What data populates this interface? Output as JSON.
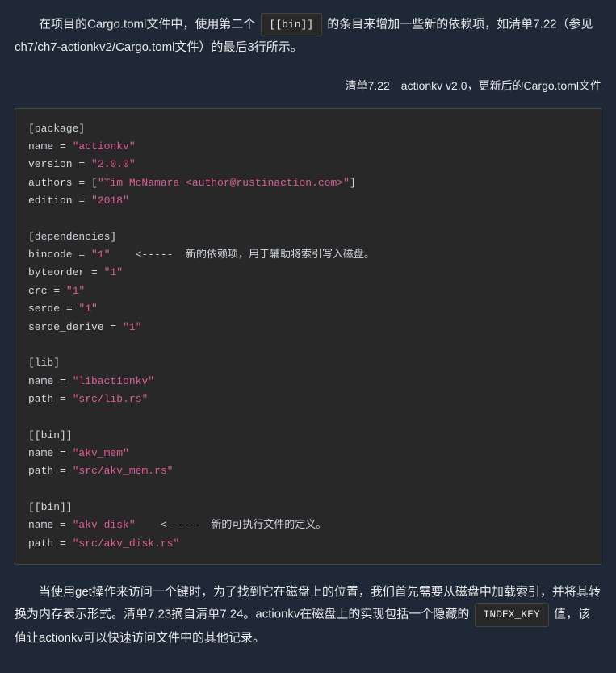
{
  "para1_part1": "在项目的Cargo.toml文件中，使用第二个 ",
  "inline_bin": "[[bin]]",
  "para1_part2": " 的条目来增加一些新的依赖项，如清单7.22（参见ch7/ch7-actionkv2/Cargo.toml文件）的最后3行所示。",
  "caption": "清单7.22　actionkv v2.0，更新后的Cargo.toml文件",
  "code": {
    "l1_section": "[package]",
    "l2_key": "name",
    "l2_val": "\"actionkv\"",
    "l3_key": "version",
    "l3_val": "\"2.0.0\"",
    "l4_key": "authors",
    "l4_val": "\"Tim McNamara <author@rustinaction.com>\"",
    "l5_key": "edition",
    "l5_val": "\"2018\"",
    "l6_section": "[dependencies]",
    "l7_key": "bincode",
    "l7_val": "\"1\"",
    "l7_comment": "    <-----  新的依赖项，用于辅助将索引写入磁盘。",
    "l8_key": "byteorder",
    "l8_val": "\"1\"",
    "l9_key": "crc",
    "l9_val": "\"1\"",
    "l10_key": "serde",
    "l10_val": "\"1\"",
    "l11_key": "serde_derive",
    "l11_val": "\"1\"",
    "l12_section": "[lib]",
    "l13_key": "name",
    "l13_val": "\"libactionkv\"",
    "l14_key": "path",
    "l14_val": "\"src/lib.rs\"",
    "l15_section": "[[bin]]",
    "l16_key": "name",
    "l16_val": "\"akv_mem\"",
    "l17_key": "path",
    "l17_val": "\"src/akv_mem.rs\"",
    "l18_section": "[[bin]]",
    "l19_key": "name",
    "l19_val": "\"akv_disk\"",
    "l19_comment": "    <-----  新的可执行文件的定义。",
    "l20_key": "path",
    "l20_val": "\"src/akv_disk.rs\""
  },
  "para2_part1": "当使用get操作来访问一个键时，为了找到它在磁盘上的位置，我们首先需要从磁盘中加载索引，并将其转换为内存表示形式。清单7.23摘自清单7.24。actionkv在磁盘上的实现包括一个隐藏的 ",
  "inline_indexkey": "INDEX_KEY",
  "para2_part2": " 值，该值让actionkv可以快速访问文件中的其他记录。"
}
